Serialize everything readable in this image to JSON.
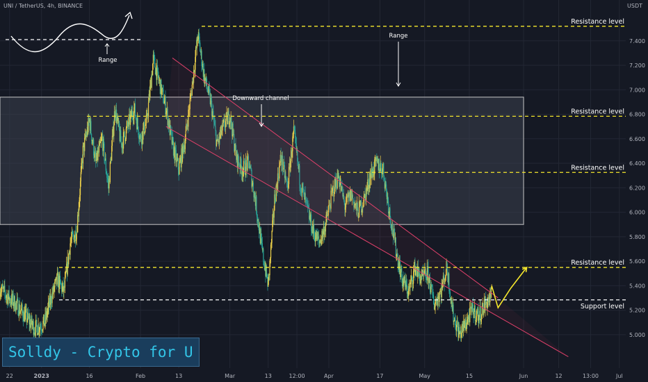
{
  "header": {
    "symbol_label": "UNI / TetherUS, 4h, BINANCE",
    "currency": "USDT"
  },
  "branding": {
    "text": "Solldy - Crypto for U"
  },
  "colors": {
    "background": "#151924",
    "candle_up": "#f0d34a",
    "candle_down": "#26a69a",
    "resistance_line": "#f5e72c",
    "support_line": "#ffffff",
    "channel_line": "#e0406a",
    "range_box_fill": "#3a3f4c",
    "projection": "#f5e72c"
  },
  "chart_data": {
    "type": "candlestick",
    "y_axis": {
      "min": 4.88,
      "max": 7.62,
      "ticks": [
        5.0,
        5.2,
        5.4,
        5.6,
        5.8,
        6.0,
        6.2,
        6.4,
        6.6,
        6.8,
        7.0,
        7.2,
        7.4
      ],
      "tick_labels": [
        "5.000",
        "5.200",
        "5.400",
        "5.600",
        "5.800",
        "6.000",
        "6.200",
        "6.400",
        "6.600",
        "6.800",
        "7.000",
        "7.200",
        "7.400"
      ]
    },
    "x_axis": {
      "start": "2022-12-19",
      "end": "2023-07-03",
      "ticks": [
        {
          "date": "2022-12-22",
          "label": "22",
          "bold": false
        },
        {
          "date": "2023-01-01",
          "label": "2023",
          "bold": true
        },
        {
          "date": "2023-01-16",
          "label": "16",
          "bold": false
        },
        {
          "date": "2023-02-01",
          "label": "Feb",
          "bold": false
        },
        {
          "date": "2023-02-13",
          "label": "13",
          "bold": false
        },
        {
          "date": "2023-03-01",
          "label": "Mar",
          "bold": false
        },
        {
          "date": "2023-03-13",
          "label": "13",
          "bold": false
        },
        {
          "date": "2023-03-22",
          "label": "12:00",
          "bold": false
        },
        {
          "date": "2023-04-01",
          "label": "Apr",
          "bold": false
        },
        {
          "date": "2023-04-17",
          "label": "17",
          "bold": false
        },
        {
          "date": "2023-05-01",
          "label": "May",
          "bold": false
        },
        {
          "date": "2023-05-15",
          "label": "15",
          "bold": false
        },
        {
          "date": "2023-06-01",
          "label": "Jun",
          "bold": false
        },
        {
          "date": "2023-06-12",
          "label": "12",
          "bold": false
        },
        {
          "date": "2023-06-22",
          "label": "13:00",
          "bold": false
        },
        {
          "date": "2023-07-01",
          "label": "Jul",
          "bold": false
        }
      ]
    },
    "price_path": [
      [
        "2022-12-19",
        5.38
      ],
      [
        "2022-12-21",
        5.32
      ],
      [
        "2022-12-24",
        5.25
      ],
      [
        "2022-12-27",
        5.15
      ],
      [
        "2022-12-30",
        5.05
      ],
      [
        "2023-01-02",
        5.1
      ],
      [
        "2023-01-04",
        5.3
      ],
      [
        "2023-01-06",
        5.45
      ],
      [
        "2023-01-08",
        5.35
      ],
      [
        "2023-01-10",
        5.75
      ],
      [
        "2023-01-12",
        5.85
      ],
      [
        "2023-01-14",
        6.5
      ],
      [
        "2023-01-16",
        6.75
      ],
      [
        "2023-01-18",
        6.4
      ],
      [
        "2023-01-20",
        6.6
      ],
      [
        "2023-01-22",
        6.2
      ],
      [
        "2023-01-24",
        6.85
      ],
      [
        "2023-01-26",
        6.55
      ],
      [
        "2023-01-28",
        6.7
      ],
      [
        "2023-01-30",
        6.85
      ],
      [
        "2023-02-01",
        6.6
      ],
      [
        "2023-02-03",
        6.75
      ],
      [
        "2023-02-05",
        7.25
      ],
      [
        "2023-02-07",
        7.05
      ],
      [
        "2023-02-09",
        6.85
      ],
      [
        "2023-02-11",
        6.55
      ],
      [
        "2023-02-13",
        6.35
      ],
      [
        "2023-02-15",
        6.6
      ],
      [
        "2023-02-17",
        7.0
      ],
      [
        "2023-02-19",
        7.45
      ],
      [
        "2023-02-21",
        7.1
      ],
      [
        "2023-02-23",
        6.9
      ],
      [
        "2023-02-25",
        6.55
      ],
      [
        "2023-02-27",
        6.7
      ],
      [
        "2023-03-01",
        6.8
      ],
      [
        "2023-03-03",
        6.45
      ],
      [
        "2023-03-05",
        6.35
      ],
      [
        "2023-03-07",
        6.4
      ],
      [
        "2023-03-09",
        6.1
      ],
      [
        "2023-03-11",
        5.7
      ],
      [
        "2023-03-13",
        5.4
      ],
      [
        "2023-03-15",
        6.1
      ],
      [
        "2023-03-17",
        6.45
      ],
      [
        "2023-03-19",
        6.2
      ],
      [
        "2023-03-21",
        6.65
      ],
      [
        "2023-03-23",
        6.25
      ],
      [
        "2023-03-25",
        6.05
      ],
      [
        "2023-03-27",
        5.85
      ],
      [
        "2023-03-29",
        5.75
      ],
      [
        "2023-03-31",
        5.9
      ],
      [
        "2023-04-02",
        6.15
      ],
      [
        "2023-04-04",
        6.3
      ],
      [
        "2023-04-06",
        6.05
      ],
      [
        "2023-04-08",
        6.15
      ],
      [
        "2023-04-10",
        6.0
      ],
      [
        "2023-04-12",
        6.1
      ],
      [
        "2023-04-14",
        6.3
      ],
      [
        "2023-04-16",
        6.4
      ],
      [
        "2023-04-18",
        6.35
      ],
      [
        "2023-04-20",
        6.0
      ],
      [
        "2023-04-22",
        5.7
      ],
      [
        "2023-04-24",
        5.45
      ],
      [
        "2023-04-26",
        5.35
      ],
      [
        "2023-04-28",
        5.55
      ],
      [
        "2023-04-30",
        5.45
      ],
      [
        "2023-05-02",
        5.5
      ],
      [
        "2023-05-04",
        5.25
      ],
      [
        "2023-05-06",
        5.35
      ],
      [
        "2023-05-08",
        5.55
      ],
      [
        "2023-05-10",
        5.15
      ],
      [
        "2023-05-12",
        5.0
      ],
      [
        "2023-05-14",
        5.1
      ],
      [
        "2023-05-16",
        5.2
      ],
      [
        "2023-05-18",
        5.15
      ],
      [
        "2023-05-20",
        5.25
      ],
      [
        "2023-05-22",
        5.32
      ]
    ],
    "resistance_levels": [
      {
        "value": 7.519,
        "label": "Resistance level",
        "price_tag": "7.519"
      },
      {
        "value": 6.784,
        "label": "Resistance level",
        "price_tag": "6.784"
      },
      {
        "value": 6.325,
        "label": "Resistance level",
        "price_tag": "6.325"
      },
      {
        "value": 5.549,
        "label": "Resistance level",
        "price_tag": "5.549"
      }
    ],
    "support_level": {
      "value": 5.284,
      "label": "Support level",
      "price_tag": "5.284"
    },
    "current_price": {
      "value": 5.318,
      "price_tag": "5.318"
    },
    "range_box": {
      "start": "2022-12-19",
      "end": "2023-06-01",
      "top": 6.94,
      "bottom": 5.9
    },
    "downward_channel": {
      "upper": {
        "start": [
          "2023-02-11",
          7.26
        ],
        "end": [
          "2023-05-24",
          5.3
        ]
      },
      "lower": {
        "start": [
          "2023-02-09",
          6.7
        ],
        "end": [
          "2023-06-15",
          4.82
        ]
      }
    },
    "projection_path": [
      [
        "2023-05-22",
        5.4
      ],
      [
        "2023-05-24",
        5.22
      ],
      [
        "2023-05-28",
        5.38
      ],
      [
        "2023-06-02",
        5.55
      ]
    ],
    "annotations": [
      {
        "text": "Range",
        "kind": "range-legend"
      },
      {
        "text": "Range",
        "kind": "range-arrow"
      },
      {
        "text": "Downward channel",
        "kind": "channel-arrow"
      }
    ]
  }
}
